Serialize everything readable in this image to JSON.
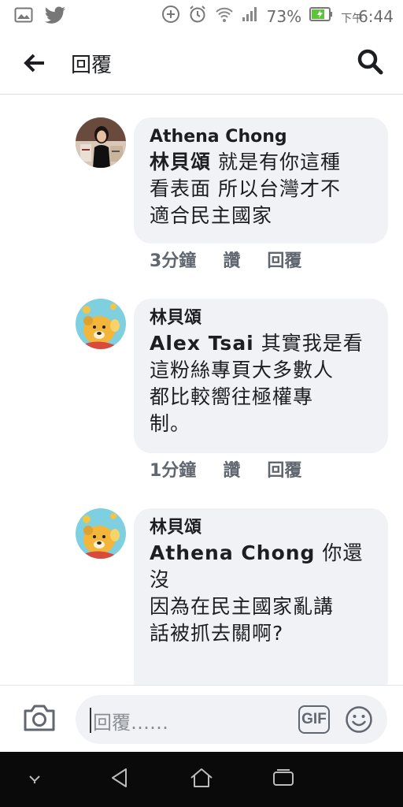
{
  "status_bar": {
    "battery": "73%",
    "time_prefix": "下午",
    "time": "6:44",
    "icons": [
      "gallery-icon",
      "twitter-icon",
      "add-circle-icon",
      "alarm-icon",
      "wifi-icon",
      "signal-icon",
      "battery-icon"
    ]
  },
  "header": {
    "title": "回覆",
    "back_icon": "arrow-left-icon",
    "search_icon": "search-icon"
  },
  "comments": [
    {
      "author": "Athena Chong",
      "mention": "林貝頌",
      "text_lines": [
        "就是有你這種",
        "看表面 所以台灣才不",
        "適合民主國家"
      ],
      "time": "3分鐘",
      "like": "讚",
      "reply": "回覆"
    },
    {
      "author": "林貝頌",
      "mention": "Alex Tsai",
      "text_lines": [
        "其實我是看",
        "這粉絲專頁大多數人",
        "都比較嚮往極權專",
        "制。"
      ],
      "time": "1分鐘",
      "like": "讚",
      "reply": "回覆"
    },
    {
      "author": "林貝頌",
      "mention": "Athena Chong",
      "text_lines": [
        "你還沒",
        "因為在民主國家亂講",
        "話被抓去關啊?"
      ]
    }
  ],
  "reply_bar": {
    "placeholder": "回覆……",
    "gif_label": "GIF",
    "camera_icon": "camera-icon",
    "emoji_icon": "emoji-icon"
  },
  "nav_bar": {
    "icons": [
      "chevron-down-icon",
      "back-triangle-icon",
      "home-icon",
      "recents-icon"
    ]
  },
  "colors": {
    "bubble": "#f0f2f5",
    "meta_text": "#606770",
    "nav_bg": "#0a0a0a",
    "battery_green": "#5cc33b"
  }
}
